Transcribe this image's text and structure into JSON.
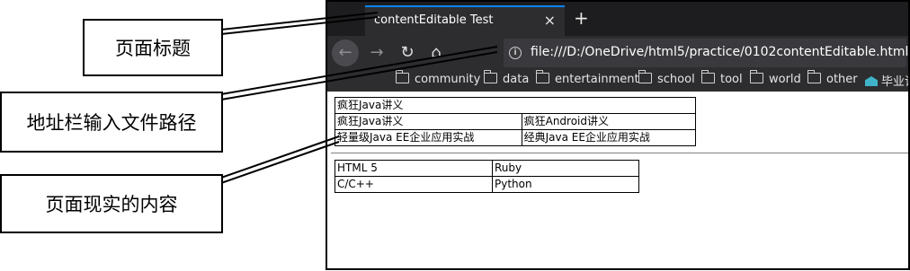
{
  "browser": {
    "tab_title": "contentEditable Test",
    "tab_close": "×",
    "new_tab": "+",
    "back": "←",
    "forward": "→",
    "reload": "↻",
    "home": "⌂",
    "info": "i",
    "url": "file:///D:/OneDrive/html5/practice/0102contentEditable.html",
    "bookmarks": [
      "community",
      "data",
      "entertainment",
      "school",
      "tool",
      "world",
      "other",
      "毕业论"
    ]
  },
  "page": {
    "table1": {
      "caption": "疯狂Java讲义",
      "rows": [
        [
          "疯狂Java讲义",
          "疯狂Android讲义"
        ],
        [
          "轻量级Java EE企业应用实战",
          "经典Java EE企业应用实战"
        ]
      ]
    },
    "table2": {
      "rows": [
        [
          "HTML 5",
          "Ruby"
        ],
        [
          "C/C++",
          "Python"
        ]
      ]
    }
  },
  "callouts": {
    "title": "页面标题",
    "address": "地址栏输入文件路径",
    "content": "页面现实的内容"
  },
  "colors": {
    "tab_accent": "#0a84ff",
    "chrome_dark": "#1d1d1f",
    "toolbar": "#2d2d30"
  }
}
